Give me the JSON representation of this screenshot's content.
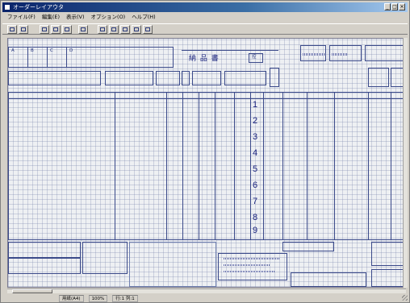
{
  "window": {
    "title": "オーダーレイアウタ",
    "buttons": [
      "_",
      "□",
      "×"
    ]
  },
  "menu": [
    "ファイル(F)",
    "編集(E)",
    "表示(V)",
    "オプション(O)",
    "ヘルプ(H)"
  ],
  "toolbar": [
    "undo",
    "new",
    "open",
    "save",
    "print",
    "copy",
    "cut",
    "paste",
    "pencil",
    "line"
  ],
  "form": {
    "header_cells": [
      "A",
      "B",
      "C",
      "D"
    ],
    "heading": "納 品 書",
    "stamp": "控",
    "row_numbers": [
      "1",
      "2",
      "3",
      "4",
      "5",
      "6",
      "7",
      "8",
      "9"
    ]
  },
  "status": {
    "segments": [
      "用紙(A4)",
      "100%",
      "行:1 列:1"
    ]
  }
}
